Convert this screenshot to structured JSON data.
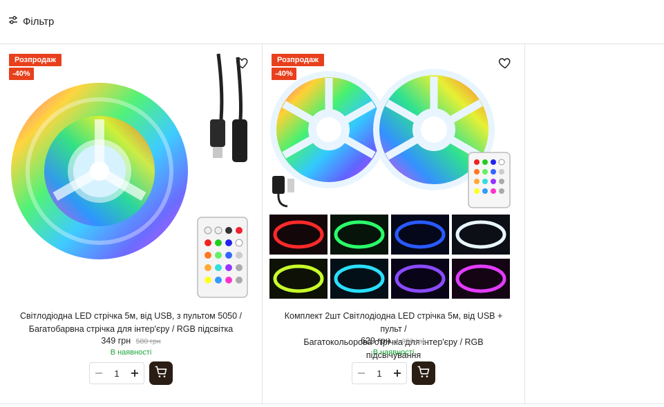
{
  "toolbar": {
    "filter_label": "Фільтр"
  },
  "products": [
    {
      "badge_sale": "Розпродаж",
      "badge_discount": "-40%",
      "title_line1": "Світлодіодна LED стрічка 5м, від USB, з пультом 5050 /",
      "title_line2": "Багатобарвна стрічка для інтер'єру / RGB підсвітка",
      "price": "349 грн",
      "old_price": "580 грн",
      "stock": "В наявності",
      "quantity": "1"
    },
    {
      "badge_sale": "Розпродаж",
      "badge_discount": "-40%",
      "title_line1": "Комплект 2шт Світлодіодна LED стрічка 5м, від USB + пульт /",
      "title_line2": "Багатокольорова стрічка для інтер'єру / RGB підсвічування",
      "price": "629 грн",
      "old_price": "1 050 грн",
      "stock": "В наявності",
      "quantity": "1"
    }
  ],
  "colors": {
    "accent": "#e8401c",
    "in_stock": "#1aa33a",
    "cart_button": "#2a1e14"
  }
}
